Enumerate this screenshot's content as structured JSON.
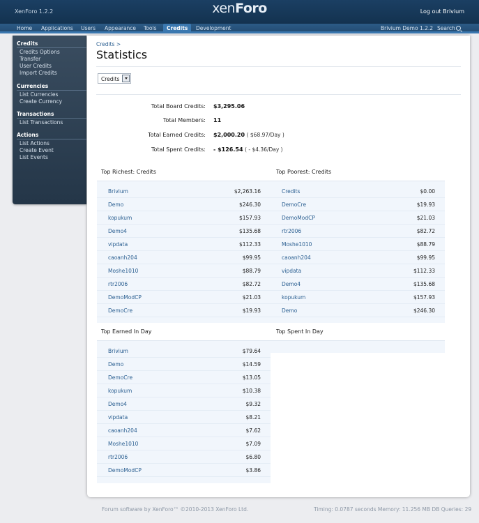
{
  "header": {
    "version": "XenForo 1.2.2",
    "logo_left": "xen",
    "logo_right": "Foro",
    "logout": "Log out Brivium"
  },
  "nav": {
    "tabs": [
      "Home",
      "Applications",
      "Users",
      "Appearance",
      "Tools",
      "Credits",
      "Development"
    ],
    "active": "Credits",
    "site": "Brivium Demo 1.2.2",
    "search": "Search"
  },
  "sidebar": {
    "groups": [
      {
        "title": "Credits",
        "items": [
          "Credits Options",
          "Transfer",
          "User Credits",
          "Import Credits"
        ]
      },
      {
        "title": "Currencies",
        "items": [
          "List Currencies",
          "Create Currency"
        ]
      },
      {
        "title": "Transactions",
        "items": [
          "List Transactions"
        ]
      },
      {
        "title": "Actions",
        "items": [
          "List Actions",
          "Create Event",
          "List Events"
        ]
      }
    ]
  },
  "main": {
    "breadcrumb": "Credits >",
    "title": "Statistics",
    "currency_select": "Credits",
    "stats": [
      {
        "label": "Total Board Credits:",
        "value": "$3,295.06",
        "extra": ""
      },
      {
        "label": "Total Members:",
        "value": "11",
        "extra": ""
      },
      {
        "label": "Total Earned Credits:",
        "value": "$2,000.20",
        "extra": "( $68.97/Day )"
      },
      {
        "label": "Total Spent Credits:",
        "value": "- $126.54",
        "extra": "( - $4.36/Day )"
      }
    ],
    "richest": {
      "title": "Top Richest: Credits",
      "rows": [
        {
          "name": "Brivium",
          "amount": "$2,263.16"
        },
        {
          "name": "Demo",
          "amount": "$246.30"
        },
        {
          "name": "kopukum",
          "amount": "$157.93"
        },
        {
          "name": "Demo4",
          "amount": "$135.68"
        },
        {
          "name": "vipdata",
          "amount": "$112.33"
        },
        {
          "name": "caoanh204",
          "amount": "$99.95"
        },
        {
          "name": "Moshe1010",
          "amount": "$88.79"
        },
        {
          "name": "rtr2006",
          "amount": "$82.72"
        },
        {
          "name": "DemoModCP",
          "amount": "$21.03"
        },
        {
          "name": "DemoCre",
          "amount": "$19.93"
        }
      ]
    },
    "poorest": {
      "title": "Top Poorest: Credits",
      "rows": [
        {
          "name": "Credits",
          "amount": "$0.00"
        },
        {
          "name": "DemoCre",
          "amount": "$19.93"
        },
        {
          "name": "DemoModCP",
          "amount": "$21.03"
        },
        {
          "name": "rtr2006",
          "amount": "$82.72"
        },
        {
          "name": "Moshe1010",
          "amount": "$88.79"
        },
        {
          "name": "caoanh204",
          "amount": "$99.95"
        },
        {
          "name": "vipdata",
          "amount": "$112.33"
        },
        {
          "name": "Demo4",
          "amount": "$135.68"
        },
        {
          "name": "kopukum",
          "amount": "$157.93"
        },
        {
          "name": "Demo",
          "amount": "$246.30"
        }
      ]
    },
    "earned": {
      "title": "Top Earned In Day",
      "rows": [
        {
          "name": "Brivium",
          "amount": "$79.64"
        },
        {
          "name": "Demo",
          "amount": "$14.59"
        },
        {
          "name": "DemoCre",
          "amount": "$13.05"
        },
        {
          "name": "kopukum",
          "amount": "$10.38"
        },
        {
          "name": "Demo4",
          "amount": "$9.32"
        },
        {
          "name": "vipdata",
          "amount": "$8.21"
        },
        {
          "name": "caoanh204",
          "amount": "$7.62"
        },
        {
          "name": "Moshe1010",
          "amount": "$7.09"
        },
        {
          "name": "rtr2006",
          "amount": "$6.80"
        },
        {
          "name": "DemoModCP",
          "amount": "$3.86"
        }
      ]
    },
    "spent": {
      "title": "Top Spent In Day",
      "rows": []
    }
  },
  "footer": {
    "copyright": "Forum software by XenForo™ ©2010-2013 XenForo Ltd.",
    "timing": "Timing: 0.0787 seconds Memory: 11.256 MB DB Queries: 29"
  }
}
